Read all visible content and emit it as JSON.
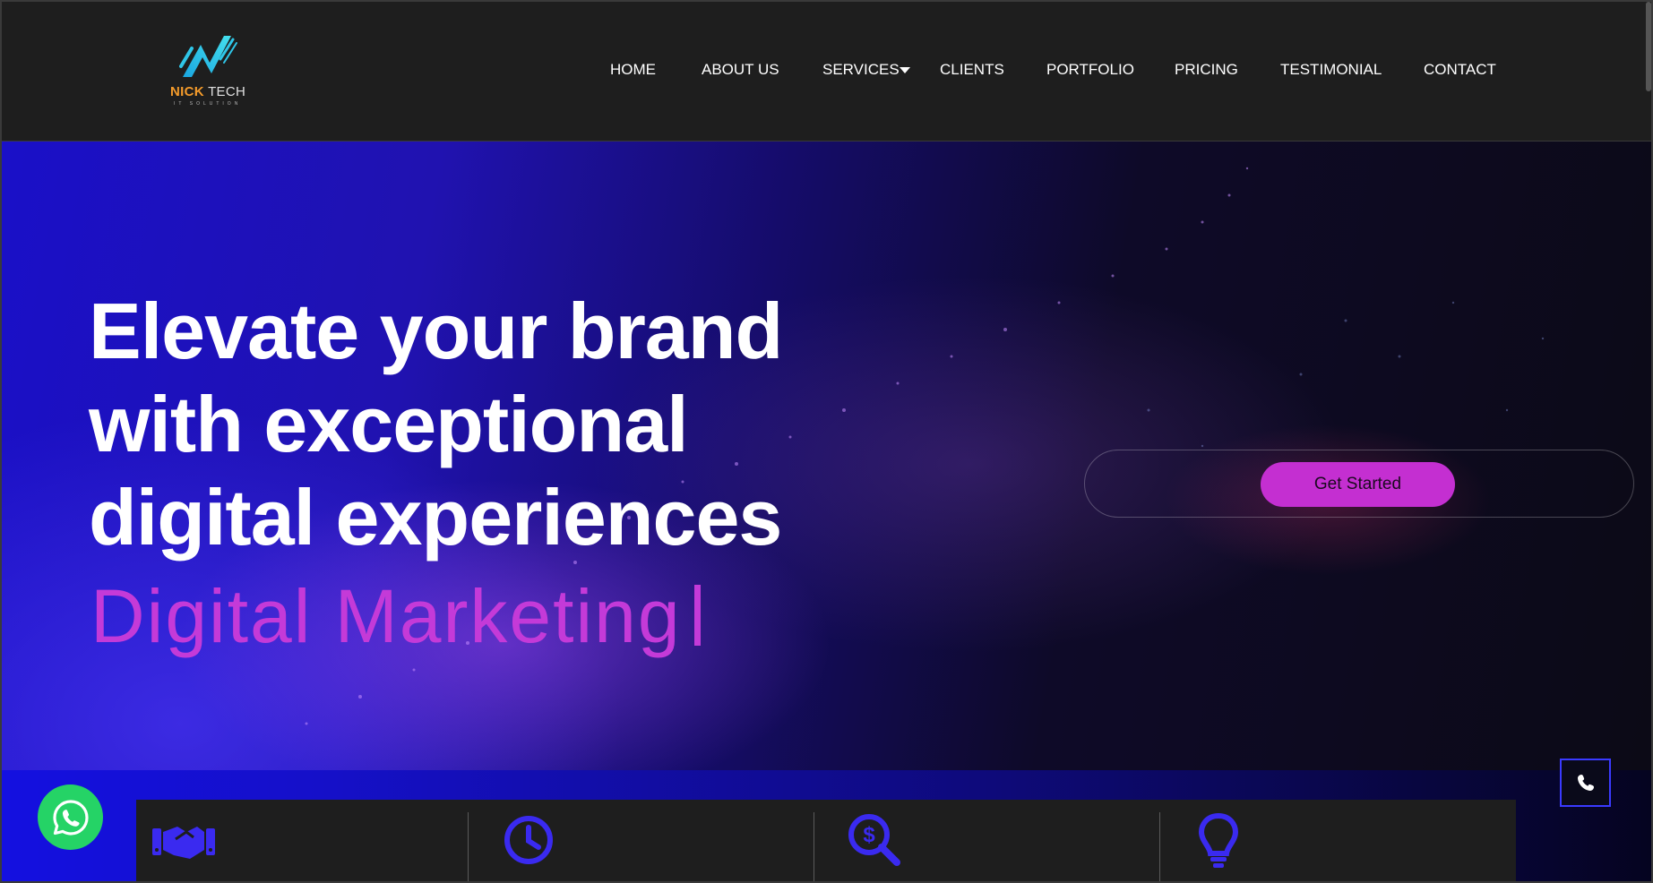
{
  "brand": {
    "name_part1": "NICK",
    "name_part2": " TECH",
    "tagline": "IT SOLUTION",
    "colors": {
      "accent_orange": "#f49b2b",
      "logo_cyan": "#2fc6e8"
    }
  },
  "nav": {
    "items": [
      {
        "label": "HOME"
      },
      {
        "label": "ABOUT US"
      },
      {
        "label": "SERVICES",
        "has_dropdown": true
      },
      {
        "label": "CLIENTS"
      },
      {
        "label": "PORTFOLIO"
      },
      {
        "label": "PRICING"
      },
      {
        "label": "TESTIMONIAL"
      },
      {
        "label": "CONTACT"
      }
    ]
  },
  "hero": {
    "headline_line1": "Elevate your brand",
    "headline_line2": "with exceptional",
    "headline_line3": "digital experiences",
    "typed_text": "Digital Marketing",
    "cta_label": "Get Started",
    "colors": {
      "typed": "#c43ad8",
      "cta_bg": "#c42fd1"
    }
  },
  "features": {
    "items": [
      {
        "icon": "handshake-icon"
      },
      {
        "icon": "clock-icon"
      },
      {
        "icon": "dollar-search-icon"
      },
      {
        "icon": "lightbulb-icon"
      }
    ],
    "icon_color": "#3a2af0"
  },
  "floating": {
    "whatsapp_icon": "whatsapp-icon",
    "phone_icon": "phone-icon",
    "whatsapp_color": "#25d366"
  }
}
